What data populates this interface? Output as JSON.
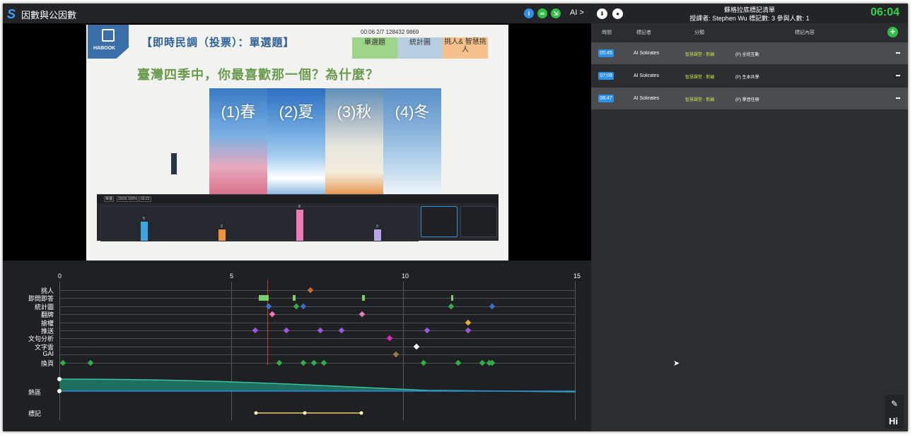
{
  "app": {
    "title": "因數與公因數",
    "ai_button": "AI >"
  },
  "slide": {
    "brand": "HABOOK",
    "title": "【即時民調（投票）：單選題】",
    "question": "臺灣四季中，你最喜歡那一個？為什麼？",
    "seasons": [
      "(1)春",
      "(2)夏",
      "(3)秋",
      "(4)冬"
    ],
    "vote_info": "00:06  2/7  128432  9869",
    "tabs": [
      "單選題",
      "統計圖",
      "挑人&\n智慧挑人"
    ]
  },
  "stats": {
    "chips": [
      "單選",
      "20/20 100%",
      "00:22"
    ],
    "chart_data": {
      "type": "bar",
      "categories": [
        "1",
        "2",
        "3",
        "4"
      ],
      "values": [
        5,
        3,
        8,
        3
      ],
      "colors": [
        "#35a8e8",
        "#f4943a",
        "#f07ab8",
        "#b8a6e8"
      ]
    }
  },
  "timeline": {
    "ticks": [
      "0",
      "5",
      "10",
      "15"
    ],
    "rows": [
      "挑人",
      "即問即答",
      "統計圖",
      "翻牌",
      "搶權",
      "推送",
      "文句分析",
      "文字雲",
      "GAI",
      "換頁"
    ],
    "heat_label": "熱區",
    "mark_label": "標記"
  },
  "right_panel": {
    "title": "蘇格拉底標記清單",
    "subtitle": "授課者: Stephen Wu 標記數: 3 參與人數: 1",
    "clock": "06:04",
    "columns": [
      "時間",
      "標記者",
      "分類",
      "標記內容"
    ],
    "rows": [
      {
        "time": "05:45",
        "who": "AI Sokrates",
        "category": "智慧課堂 - 新穎",
        "content": "(P) 全班互動"
      },
      {
        "time": "07:09",
        "who": "AI Sokrates",
        "category": "智慧課堂 - 新穎",
        "content": "(P) 生本共學"
      },
      {
        "time": "08:47",
        "who": "AI Sokrates",
        "category": "智慧課堂 - 新穎",
        "content": "(P) 學習任務"
      }
    ],
    "hi_label": "Hi"
  }
}
